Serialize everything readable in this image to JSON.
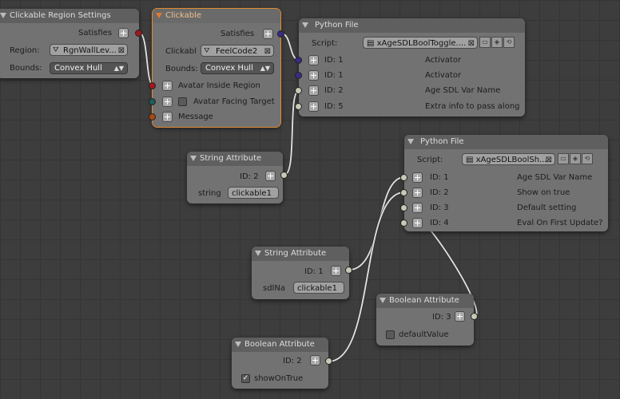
{
  "colors": {
    "grid_bg": "#3d3d3d",
    "node_body": "#727272",
    "active_outline": "#e08a30",
    "socket_red": "#a01820",
    "socket_purple": "#3b2a82",
    "socket_teal": "#1b5e5a",
    "socket_orange": "#a84a10",
    "socket_grey": "#c8c8b4"
  },
  "icons": {
    "plus": "plus-icon",
    "clear": "x-icon",
    "collapse": "triangle-down-icon",
    "region": "region-pointer-icon",
    "script": "text-file-icon"
  },
  "nodes": {
    "region_settings": {
      "title": "Clickable Region Settings",
      "satisfies": "Satisfies",
      "region_label": "Region:",
      "region_value": "RgnWallLev...",
      "bounds_label": "Bounds:",
      "bounds_value": "Convex Hull"
    },
    "clickable": {
      "title": "Clickable",
      "satisfies": "Satisfies",
      "clickable_label": "Clickabl",
      "clickable_value": "FeelCode2",
      "bounds_label": "Bounds:",
      "bounds_value": "Convex Hull",
      "inputs": [
        "Avatar Inside Region",
        "Avatar Facing Target",
        "Message"
      ]
    },
    "python1": {
      "title": "Python File",
      "script_label": "Script:",
      "script_value": "xAgeSDLBoolToggle....",
      "rows": [
        {
          "id": "ID: 1",
          "desc": "Activator"
        },
        {
          "id": "ID: 1",
          "desc": "Activator"
        },
        {
          "id": "ID: 2",
          "desc": "Age SDL Var Name"
        },
        {
          "id": "ID: 5",
          "desc": "Extra info to pass along"
        }
      ]
    },
    "string1": {
      "title": "String Attribute",
      "id": "ID: 2",
      "field_label": "string",
      "field_value": "clickable1"
    },
    "python2": {
      "title": "Python File",
      "script_label": "Script:",
      "script_value": "xAgeSDLBoolSh...",
      "rows": [
        {
          "id": "ID: 1",
          "desc": "Age SDL Var Name"
        },
        {
          "id": "ID: 2",
          "desc": "Show on true"
        },
        {
          "id": "ID: 3",
          "desc": "Default setting"
        },
        {
          "id": "ID: 4",
          "desc": "Eval On First Update?"
        }
      ]
    },
    "string2": {
      "title": "String Attribute",
      "id": "ID: 1",
      "field_label": "sdlNa",
      "field_value": "clickable1"
    },
    "bool1": {
      "title": "Boolean Attribute",
      "id": "ID: 3",
      "check_label": "defaultValue",
      "checked": false
    },
    "bool2": {
      "title": "Boolean Attribute",
      "id": "ID: 2",
      "check_label": "showOnTrue",
      "checked": true
    }
  }
}
